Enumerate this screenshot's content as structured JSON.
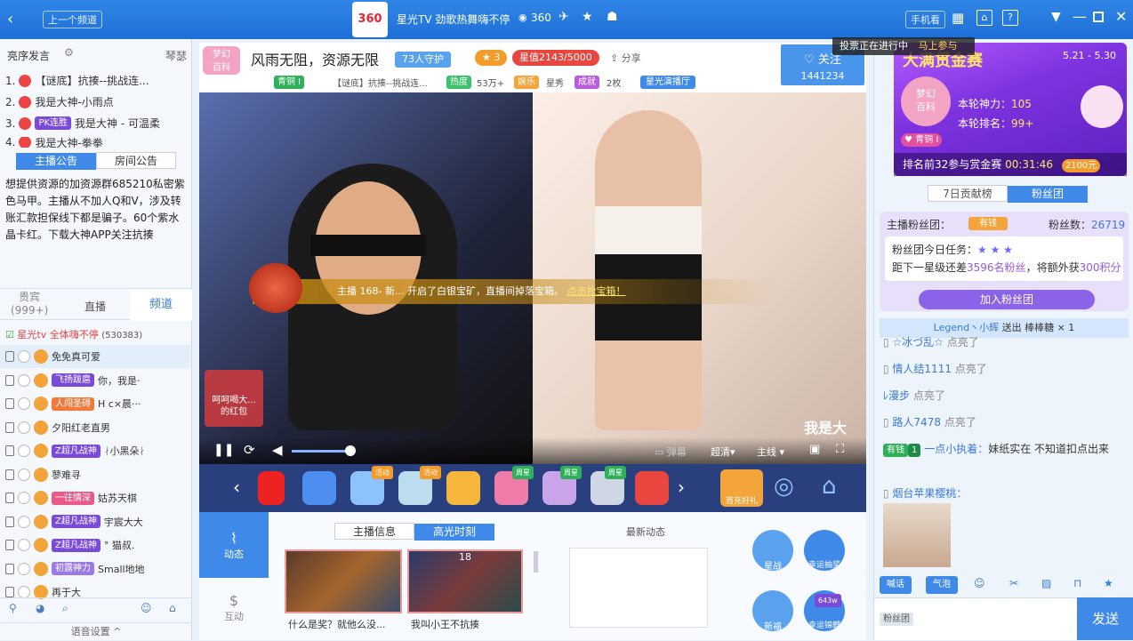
{
  "topbar": {
    "prev_channel": "上一个频道",
    "logo_text": "360",
    "channel_title": "星光TV 劲歌热舞嗨不停",
    "online_count": "360",
    "phone_watch": "手机看",
    "vote_notice": "投票正在进行中",
    "vote_join": "马上参与"
  },
  "left": {
    "tab_rank": "亮序发言",
    "tab_store": "琴瑟",
    "rank": [
      {
        "n": "1.",
        "badge": "【谜底】抗揍--挑战连..."
      },
      {
        "n": "2.",
        "text": "我是大神-小雨点"
      },
      {
        "n": "3.",
        "badge": "PK连胜",
        "text": "我是大神 - 可温柔"
      },
      {
        "n": "4.",
        "text": "我是大神-拳拳"
      }
    ],
    "notice_tabs": [
      "主播公告",
      "房间公告"
    ],
    "notice": "想提供资源的加资源群685210私密紫色马甲。主播从不加人Q和V，涉及转账汇款担保线下都是骗子。60个紫水晶卡红。下载大神APP关注抗揍",
    "user_tabs": [
      "贵宾\n(999+)",
      "直播",
      "频道"
    ],
    "channel_line": "星光tv   全体嗨不停",
    "channel_count": "(530383)",
    "users": [
      {
        "name": "免免真可爱",
        "badge": ""
      },
      {
        "name": "你，我是·",
        "badge": "飞扬跋扈"
      },
      {
        "name": "H c×晨···",
        "badge": "人闯圣碍"
      },
      {
        "name": "夕阳红老直男",
        "badge": ""
      },
      {
        "name": "ᛅ小黑朵ᛅ",
        "badge": "Z超凡战神"
      },
      {
        "name": "蓼难寻",
        "badge": ""
      },
      {
        "name": "姑苏天棋",
        "badge": "一往情深"
      },
      {
        "name": "宇宸大大",
        "badge": "Z超凡战神"
      },
      {
        "name": "° 猫叔.",
        "badge": "Z超凡战神"
      },
      {
        "name": "Small地地",
        "badge": "初露神力"
      },
      {
        "name": "再于大",
        "badge": ""
      }
    ],
    "voice_settings": "语音设置"
  },
  "room": {
    "title": "风雨无阻，资源无限",
    "guards": "73人守护",
    "star_level": "3",
    "star_value": "星值2143/5000",
    "share": "分享",
    "follow": "关注",
    "follow_count": "1441234",
    "tag_level": "青铜 I",
    "subtitle": "【谜底】抗揍--挑战连...",
    "tag_hot": "热度",
    "hot_value": "53万+",
    "tag_ent": "娱乐",
    "tag_show": "星秀",
    "tag_fan": "成就",
    "tag_fan_val": "2枚",
    "tag_hall": "星光演播厅"
  },
  "video": {
    "banner": "主播 168- 新... 开启了白银宝矿，直播间掉落宝箱。",
    "banner_link": "点击抢宝箱！",
    "redpack_line1": "呵呵喝大...",
    "redpack_line2": "的红包",
    "overlay_text": "我是大",
    "danmu": "弹幕",
    "quality": "超清",
    "line": "主线"
  },
  "gift_tags": [
    "活动",
    "活动",
    "周星",
    "周星",
    "周星"
  ],
  "gift_special": "首充好礼",
  "bottom": {
    "side_tabs": [
      "动态",
      "互动"
    ],
    "info_tabs": [
      "主播信息",
      "高光时刻"
    ],
    "clip1": "什么是奖？就他么没...",
    "clip2": "我叫小王不抗揍",
    "clip2_num": "18",
    "news_title": "最新动态",
    "act_labels": [
      "星战",
      "幸运抽奖",
      "新福",
      "幸运锦鲤"
    ],
    "act_badge": "643w"
  },
  "right": {
    "event_title": "大满贯金赛",
    "event_date": "5.21 - 5.30",
    "logo_text": "梦幻百科",
    "power_label": "本轮神力：",
    "power_value": "105",
    "rank_label": "本轮排名：",
    "rank_value": "99+",
    "tier": "青铜 I",
    "bottom_line": "排名前32参与赏金赛",
    "countdown": "00:31:46",
    "prize": "2100元",
    "tabs": [
      "7日贡献榜",
      "粉丝团"
    ],
    "fans_label": "主播粉丝团：",
    "fans_tag": "有钱",
    "fans_count_label": "粉丝数：",
    "fans_count": "26719",
    "task_label": "粉丝团今日任务：",
    "task_line_a": "距下一星级还差",
    "task_line_b": "3596名粉丝",
    "task_line_c": "，将额外获",
    "task_line_d": "300积分",
    "join_fans": "加入粉丝团",
    "gift_notice_user": "Legend丶小辉",
    "gift_notice_text": "送出",
    "gift_notice_gift": "棒棒糖 × 1",
    "chats": [
      {
        "user": "☆冰づ乱☆",
        "text": "点亮了"
      },
      {
        "user": "情人结1111",
        "text": "点亮了"
      },
      {
        "user": "ﾚ漫步",
        "text": "点亮了"
      },
      {
        "user": "路人7478",
        "text": "点亮了"
      }
    ],
    "chat_fan_tag": "有钱",
    "chat_fan_lvl": "1",
    "chat_fan_user": "一点小执着：",
    "chat_fan_msg": "妹纸实在  不知道扣点出来",
    "chat_last_user": "烟台苹果樱桃：",
    "tools": [
      "喊话",
      "气泡"
    ],
    "fans_btn": "粉丝团",
    "send": "发送"
  }
}
